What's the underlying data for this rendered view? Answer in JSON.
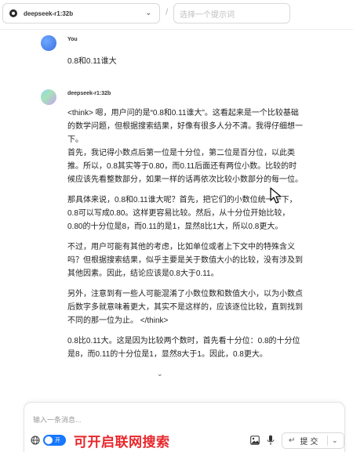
{
  "header": {
    "model_name": "deepseek-r1:32b",
    "separator": "/",
    "prompt_placeholder": "选择一个提示词"
  },
  "messages": {
    "user": {
      "sender": "You",
      "text": "0.8和0.11谁大"
    },
    "assistant": {
      "sender": "deepseek-r1:32b",
      "paragraphs": [
        "<think> 嗯，用户问的是“0.8和0.11谁大”。这看起来是一个比较基础的数学问题，但根据搜索结果，好像有很多人分不清。我得仔细想一下。",
        "首先，我记得小数点后第一位是十分位，第二位是百分位，以此类推。所以，0.8其实等于0.80，而0.11后面还有两位小数。比较的时候应该先看整数部分，如果一样的话再依次比较小数部分的每一位。",
        "那具体来说，0.8和0.11谁大呢？首先，把它们的小数位统一一下，0.8可以写成0.80。这样更容易比较。然后，从十分位开始比较，0.80的十分位是8，而0.11的是1，显然8比1大，所以0.8更大。",
        "不过，用户可能有其他的考虑，比如单位或者上下文中的特殊含义吗？但根据搜索结果，似乎主要是关于数值大小的比较，没有涉及到其他因素。因此，结论应该是0.8大于0.11。",
        "另外，注意到有一些人可能混淆了小数位数和数值大小，以为小数点后数字多就意味着更大，其实不是这样的，应该逐位比较，直到找到不同的那一位为止。 </think>",
        "0.8比0.11大。这是因为比较两个数时，首先看十分位：0.8的十分位是8，而0.11的十分位是1，显然8大于1。因此，0.8更大。"
      ]
    }
  },
  "composer": {
    "placeholder": "输入一条消息...",
    "toggle_label": "开",
    "annotation": "可开启联网搜索",
    "send_label": "提交"
  },
  "colors": {
    "accent": "#1677ff",
    "annotation": "#e8262b"
  }
}
